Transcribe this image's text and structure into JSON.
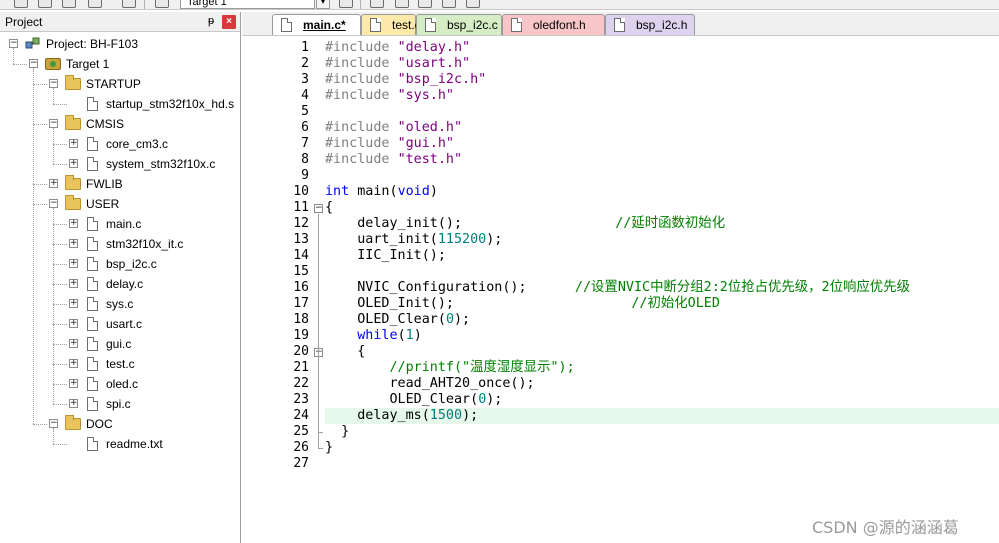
{
  "toolbar": {
    "target_value": "Target 1",
    "dropdown_glyph": "▾"
  },
  "project_panel": {
    "title": "Project",
    "pin_glyph": "ᵽ",
    "close_glyph": "×",
    "tree": [
      {
        "label": "Project: BH-F103",
        "icon": "project-icon",
        "expander": "−"
      },
      {
        "label": "Target 1",
        "icon": "target-icon",
        "expander": "−"
      },
      {
        "label": "STARTUP",
        "icon": "folder-icon",
        "expander": "−"
      },
      {
        "label": "startup_stm32f10x_hd.s",
        "icon": "file-icon",
        "expander": ""
      },
      {
        "label": "CMSIS",
        "icon": "folder-icon",
        "expander": "−"
      },
      {
        "label": "core_cm3.c",
        "icon": "file-icon",
        "expander": "+"
      },
      {
        "label": "system_stm32f10x.c",
        "icon": "file-icon",
        "expander": "+"
      },
      {
        "label": "FWLIB",
        "icon": "folder-icon",
        "expander": "+"
      },
      {
        "label": "USER",
        "icon": "folder-icon",
        "expander": "−"
      },
      {
        "label": "main.c",
        "icon": "file-icon",
        "expander": "+"
      },
      {
        "label": "stm32f10x_it.c",
        "icon": "file-icon",
        "expander": "+"
      },
      {
        "label": "bsp_i2c.c",
        "icon": "file-icon",
        "expander": "+"
      },
      {
        "label": "delay.c",
        "icon": "file-icon",
        "expander": "+"
      },
      {
        "label": "sys.c",
        "icon": "file-icon",
        "expander": "+"
      },
      {
        "label": "usart.c",
        "icon": "file-icon",
        "expander": "+"
      },
      {
        "label": "gui.c",
        "icon": "file-icon",
        "expander": "+"
      },
      {
        "label": "test.c",
        "icon": "file-icon",
        "expander": "+"
      },
      {
        "label": "oled.c",
        "icon": "file-icon",
        "expander": "+"
      },
      {
        "label": "spi.c",
        "icon": "file-icon",
        "expander": "+"
      },
      {
        "label": "DOC",
        "icon": "folder-icon",
        "expander": "−"
      },
      {
        "label": "readme.txt",
        "icon": "file-icon",
        "expander": ""
      }
    ]
  },
  "tabs": [
    {
      "label": "main.c*",
      "color": "#ffffff",
      "active": true
    },
    {
      "label": "test.c",
      "color": "#fde9a9",
      "active": false
    },
    {
      "label": "bsp_i2c.c",
      "color": "#d6ecc4",
      "active": false
    },
    {
      "label": "oledfont.h",
      "color": "#f8c6c9",
      "active": false
    },
    {
      "label": "bsp_i2c.h",
      "color": "#ddd3ee",
      "active": false
    }
  ],
  "editor": {
    "highlight_line": 24,
    "lines": [
      {
        "n": "1",
        "fold": "",
        "tokens": [
          {
            "c": "pp",
            "t": "#include "
          },
          {
            "c": "str",
            "t": "\"delay.h\""
          }
        ]
      },
      {
        "n": "2",
        "fold": "",
        "tokens": [
          {
            "c": "pp",
            "t": "#include "
          },
          {
            "c": "str",
            "t": "\"usart.h\""
          }
        ]
      },
      {
        "n": "3",
        "fold": "",
        "tokens": [
          {
            "c": "pp",
            "t": "#include "
          },
          {
            "c": "str",
            "t": "\"bsp_i2c.h\""
          }
        ]
      },
      {
        "n": "4",
        "fold": "",
        "tokens": [
          {
            "c": "pp",
            "t": "#include "
          },
          {
            "c": "str",
            "t": "\"sys.h\""
          }
        ]
      },
      {
        "n": "5",
        "fold": "",
        "tokens": []
      },
      {
        "n": "6",
        "fold": "",
        "tokens": [
          {
            "c": "pp",
            "t": "#include "
          },
          {
            "c": "str",
            "t": "\"oled.h\""
          }
        ]
      },
      {
        "n": "7",
        "fold": "",
        "tokens": [
          {
            "c": "pp",
            "t": "#include "
          },
          {
            "c": "str",
            "t": "\"gui.h\""
          }
        ]
      },
      {
        "n": "8",
        "fold": "",
        "tokens": [
          {
            "c": "pp",
            "t": "#include "
          },
          {
            "c": "str",
            "t": "\"test.h\""
          }
        ]
      },
      {
        "n": "9",
        "fold": "",
        "tokens": []
      },
      {
        "n": "10",
        "fold": "",
        "tokens": [
          {
            "c": "kw",
            "t": "int"
          },
          {
            "c": "plain",
            "t": " main("
          },
          {
            "c": "kw",
            "t": "void"
          },
          {
            "c": "plain",
            "t": ")"
          }
        ]
      },
      {
        "n": "11",
        "fold": "−",
        "tokens": [
          {
            "c": "plain",
            "t": "{"
          }
        ]
      },
      {
        "n": "12",
        "fold": "",
        "tokens": [
          {
            "c": "plain",
            "t": "    delay_init();                   "
          },
          {
            "c": "cmt",
            "t": "//延时函数初始化"
          }
        ]
      },
      {
        "n": "13",
        "fold": "",
        "tokens": [
          {
            "c": "plain",
            "t": "    uart_init("
          },
          {
            "c": "num",
            "t": "115200"
          },
          {
            "c": "plain",
            "t": ");"
          }
        ]
      },
      {
        "n": "14",
        "fold": "",
        "tokens": [
          {
            "c": "plain",
            "t": "    IIC_Init();"
          }
        ]
      },
      {
        "n": "15",
        "fold": "",
        "tokens": []
      },
      {
        "n": "16",
        "fold": "",
        "tokens": [
          {
            "c": "plain",
            "t": "    NVIC_Configuration();      "
          },
          {
            "c": "cmt",
            "t": "//设置NVIC中断分组2:2位抢占优先级，2位响应优先级"
          }
        ]
      },
      {
        "n": "17",
        "fold": "",
        "tokens": [
          {
            "c": "plain",
            "t": "    OLED_Init();                      "
          },
          {
            "c": "cmt",
            "t": "//初始化OLED"
          }
        ]
      },
      {
        "n": "18",
        "fold": "",
        "tokens": [
          {
            "c": "plain",
            "t": "    OLED_Clear("
          },
          {
            "c": "num",
            "t": "0"
          },
          {
            "c": "plain",
            "t": ");"
          }
        ]
      },
      {
        "n": "19",
        "fold": "",
        "tokens": [
          {
            "c": "plain",
            "t": "    "
          },
          {
            "c": "kw",
            "t": "while"
          },
          {
            "c": "plain",
            "t": "("
          },
          {
            "c": "num",
            "t": "1"
          },
          {
            "c": "plain",
            "t": ")"
          }
        ]
      },
      {
        "n": "20",
        "fold": "−",
        "tokens": [
          {
            "c": "plain",
            "t": "    {"
          }
        ]
      },
      {
        "n": "21",
        "fold": "",
        "tokens": [
          {
            "c": "plain",
            "t": "        "
          },
          {
            "c": "cmt",
            "t": "//printf(\"温度湿度显示\");"
          }
        ]
      },
      {
        "n": "22",
        "fold": "",
        "tokens": [
          {
            "c": "plain",
            "t": "        read_AHT20_once();"
          }
        ]
      },
      {
        "n": "23",
        "fold": "",
        "tokens": [
          {
            "c": "plain",
            "t": "        OLED_Clear("
          },
          {
            "c": "num",
            "t": "0"
          },
          {
            "c": "plain",
            "t": ");"
          }
        ]
      },
      {
        "n": "24",
        "fold": "",
        "tokens": [
          {
            "c": "plain",
            "t": "    delay_ms("
          },
          {
            "c": "num",
            "t": "1500"
          },
          {
            "c": "plain",
            "t": ");"
          }
        ]
      },
      {
        "n": "25",
        "fold": "",
        "tokens": [
          {
            "c": "plain",
            "t": "  }"
          }
        ]
      },
      {
        "n": "26",
        "fold": "",
        "tokens": [
          {
            "c": "plain",
            "t": "}"
          }
        ]
      },
      {
        "n": "27",
        "fold": "",
        "tokens": []
      }
    ]
  },
  "watermark": "CSDN @源的涵涵葛"
}
